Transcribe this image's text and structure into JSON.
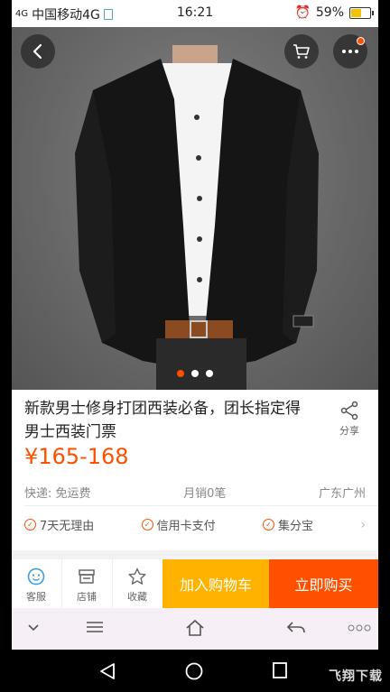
{
  "status_bar": {
    "signal": "4G",
    "carrier": "中国移动4G",
    "time": "16:21",
    "battery": "59%",
    "battery_level": 0.59
  },
  "product": {
    "title": "新款男士修身打团西装必备，团长指定得男士西装门票",
    "share_label": "分享",
    "price": "¥165-168",
    "shipping": "快递: 免运费",
    "monthly_sales": "月销0笔",
    "location": "广东广州",
    "guarantees": [
      "7天无理由",
      "信用卡支付",
      "集分宝"
    ]
  },
  "carousel": {
    "count": 3,
    "active_index": 0
  },
  "action_bar": {
    "service": "客服",
    "shop": "店铺",
    "favorite": "收藏",
    "add_to_cart": "加入购物车",
    "buy_now": "立即购买"
  },
  "watermark": "飞翔下载",
  "colors": {
    "accent": "#ff5000",
    "cart": "#ffb300"
  }
}
